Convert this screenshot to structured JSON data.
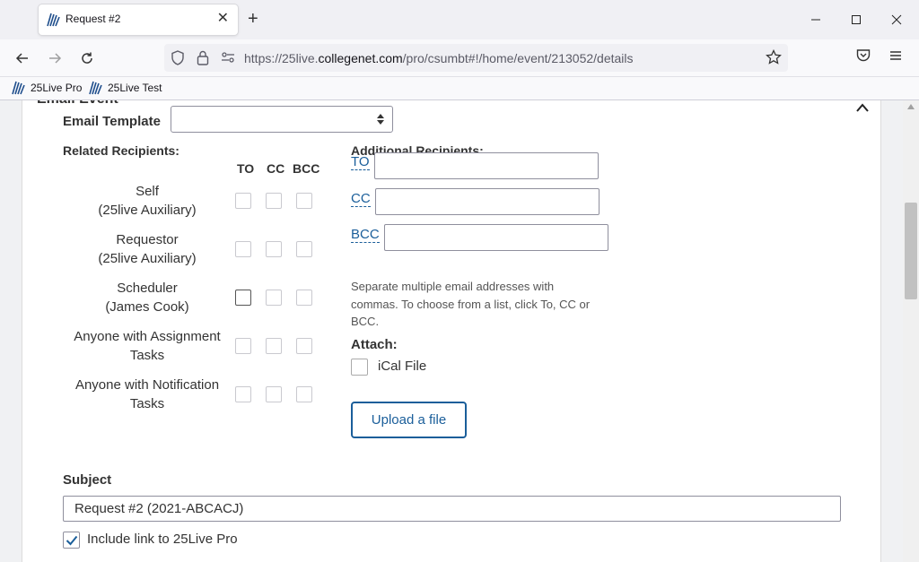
{
  "browser": {
    "tab_title": "Request #2",
    "url_prefix": "https://25live.",
    "url_domain": "collegenet.com",
    "url_path": "/pro/csumbt#!/home/event/213052/details",
    "bookmarks": [
      "25Live Pro",
      "25Live Test"
    ]
  },
  "section": {
    "title": "Email Event"
  },
  "email_template": {
    "label": "Email Template",
    "selected": ""
  },
  "related": {
    "label": "Related Recipients:",
    "columns": [
      "TO",
      "CC",
      "BCC"
    ],
    "rows": [
      {
        "line1": "Self",
        "line2": "(25live Auxiliary)"
      },
      {
        "line1": "Requestor",
        "line2": "(25live Auxiliary)"
      },
      {
        "line1": "Scheduler",
        "line2": "(James Cook)"
      },
      {
        "line1": "Anyone with Assignment",
        "line2": "Tasks"
      },
      {
        "line1": "Anyone with Notification",
        "line2": "Tasks"
      }
    ]
  },
  "additional": {
    "label": "Additional Recipients:",
    "to_label": "TO",
    "cc_label": "CC",
    "bcc_label": "BCC",
    "to_value": "",
    "cc_value": "",
    "bcc_value": "",
    "help": "Separate multiple email addresses with commas. To choose from a list, click To, CC or BCC."
  },
  "attach": {
    "label": "Attach:",
    "ical_label": "iCal File",
    "ical_checked": false,
    "upload_label": "Upload a file"
  },
  "subject": {
    "label": "Subject",
    "value": "Request #2 (2021-ABCACJ)"
  },
  "include_link": {
    "label": "Include link to 25Live Pro",
    "checked": true
  }
}
